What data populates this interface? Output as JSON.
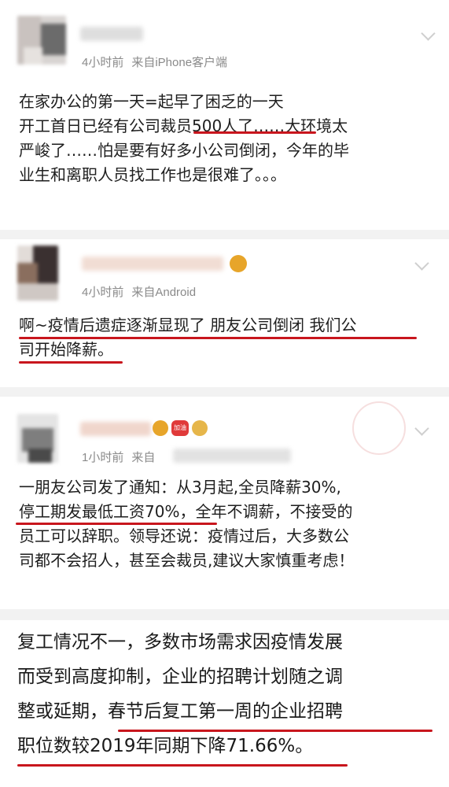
{
  "post1": {
    "meta_time": "4小时前",
    "meta_source": "来自iPhone客户端",
    "lines": [
      "在家办公的第一天=起早了困乏的一天",
      "开工首日已经有公司裁员500人了……大环境太",
      "严峻了……怕是要有好多小公司倒闭，今年的毕",
      "业生和离职人员找工作也是很难了。。。"
    ],
    "icon": "chevron-down-icon"
  },
  "post2": {
    "meta_time": "4小时前",
    "meta_source": "来自Android",
    "lines": [
      "啊~疫情后遗症逐渐显现了 朋友公司倒闭 我们公",
      "司开始降薪。"
    ],
    "icon": "chevron-down-icon"
  },
  "post3": {
    "meta_time": "1小时前",
    "meta_source": "来自",
    "heart_badge": "加油",
    "lines": [
      "一朋友公司发了通知：从3月起,全员降薪30%,",
      "停工期发最低工资70%，全年不调薪，不接受的",
      "员工可以辞职。领导还说：疫情过后，大多数公",
      "司都不会招人，甚至会裁员,建议大家慎重考虑！"
    ],
    "icon": "chevron-down-icon"
  },
  "summary": {
    "lines": [
      "复工情况不一，多数市场需求因疫情发展",
      "而受到高度抑制，企业的招聘计划随之调",
      "整或延期，春节后复工第一周的企业招聘",
      "职位数较2019年同期下降71.66%。"
    ]
  },
  "colors": {
    "underline": "#c8161d",
    "meta": "#8a8a8a",
    "divider": "#f2f2f2"
  }
}
